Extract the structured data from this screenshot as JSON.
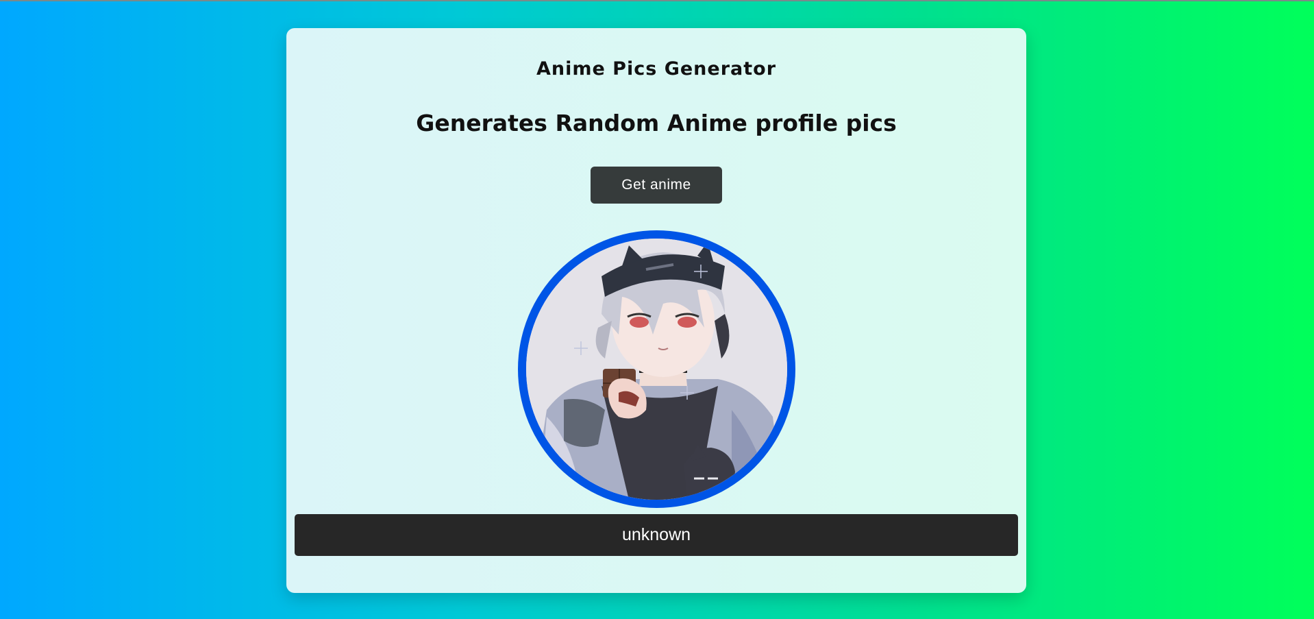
{
  "app": {
    "title": "Anime Pics Generator",
    "subtitle": "Generates Random Anime profile pics"
  },
  "actions": {
    "get_label": "Get anime"
  },
  "result": {
    "character_name": "unknown"
  },
  "colors": {
    "button_bg": "#363b3b",
    "avatar_ring": "#0055e6",
    "name_bar_bg": "#272727"
  }
}
